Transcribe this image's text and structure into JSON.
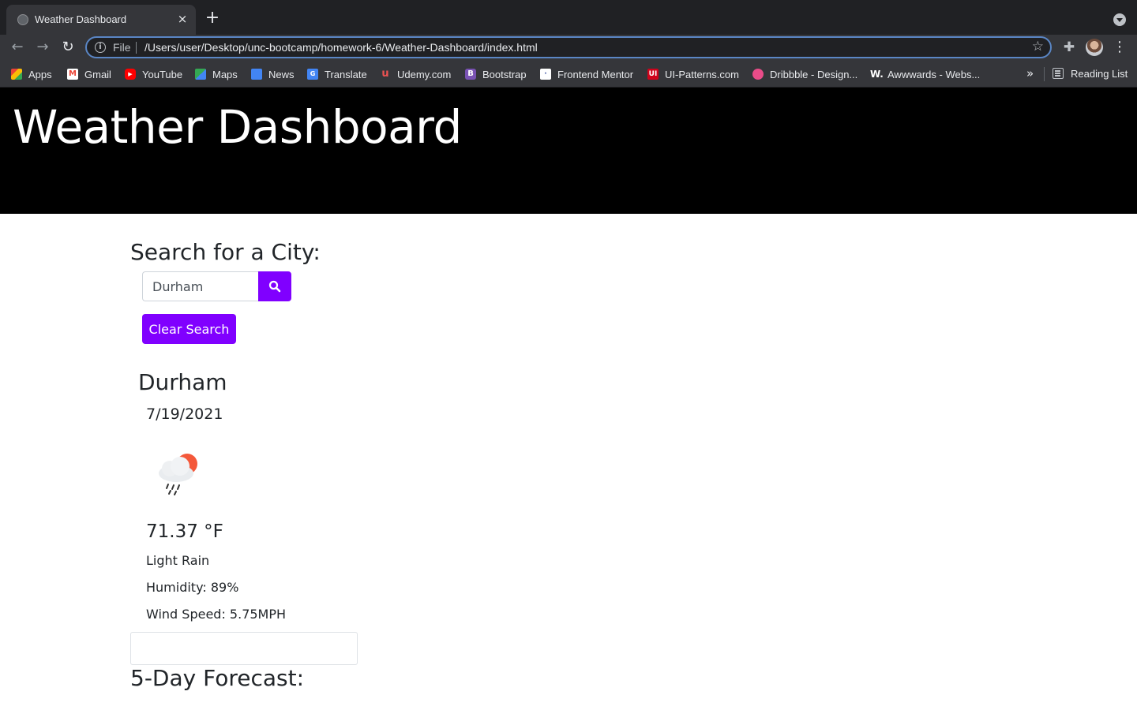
{
  "browser": {
    "tab_title": "Weather Dashboard",
    "tab_close": "×",
    "new_tab": "+",
    "scheme": "File",
    "url": "/Users/user/Desktop/unc-bootcamp/homework-6/Weather-Dashboard/index.html",
    "bookmarks": [
      {
        "label": "Apps",
        "icon": "apps-grid-icon",
        "color": "#4285f4"
      },
      {
        "label": "Gmail",
        "icon": "gmail-icon",
        "color": "#ea4335"
      },
      {
        "label": "YouTube",
        "icon": "youtube-icon",
        "color": "#ff0000"
      },
      {
        "label": "Maps",
        "icon": "maps-icon",
        "color": "#34a853"
      },
      {
        "label": "News",
        "icon": "news-icon",
        "color": "#4285f4"
      },
      {
        "label": "Translate",
        "icon": "translate-icon",
        "color": "#4285f4"
      },
      {
        "label": "Udemy.com",
        "icon": "udemy-icon",
        "color": "#ec5252"
      },
      {
        "label": "Bootstrap",
        "icon": "bootstrap-icon",
        "color": "#7952b3"
      },
      {
        "label": "Frontend Mentor",
        "icon": "frontend-mentor-icon",
        "color": "#ffffff"
      },
      {
        "label": "UI-Patterns.com",
        "icon": "ui-patterns-icon",
        "color": "#d0021b"
      },
      {
        "label": "Dribbble - Design...",
        "icon": "dribbble-icon",
        "color": "#ea4c89"
      },
      {
        "label": "Awwwards - Webs...",
        "icon": "awwwards-icon",
        "color": "#ffffff"
      }
    ],
    "more": "»",
    "reading_list": "Reading List"
  },
  "page": {
    "title": "Weather Dashboard",
    "search_heading": "Search for a City:",
    "search_value": "Durham",
    "clear_label": "Clear Search",
    "city": "Durham",
    "date": "7/19/2021",
    "weather_icon": "light-rain-cloud-sun-icon",
    "temperature": "71.37 °F",
    "description": "Light Rain",
    "humidity": "Humidity: 89%",
    "wind": "Wind Speed: 5.75MPH",
    "forecast_heading": "5-Day Forecast:"
  },
  "colors": {
    "accent": "#8000ff",
    "header_bg": "#000000",
    "chrome_bg": "#35363a"
  }
}
